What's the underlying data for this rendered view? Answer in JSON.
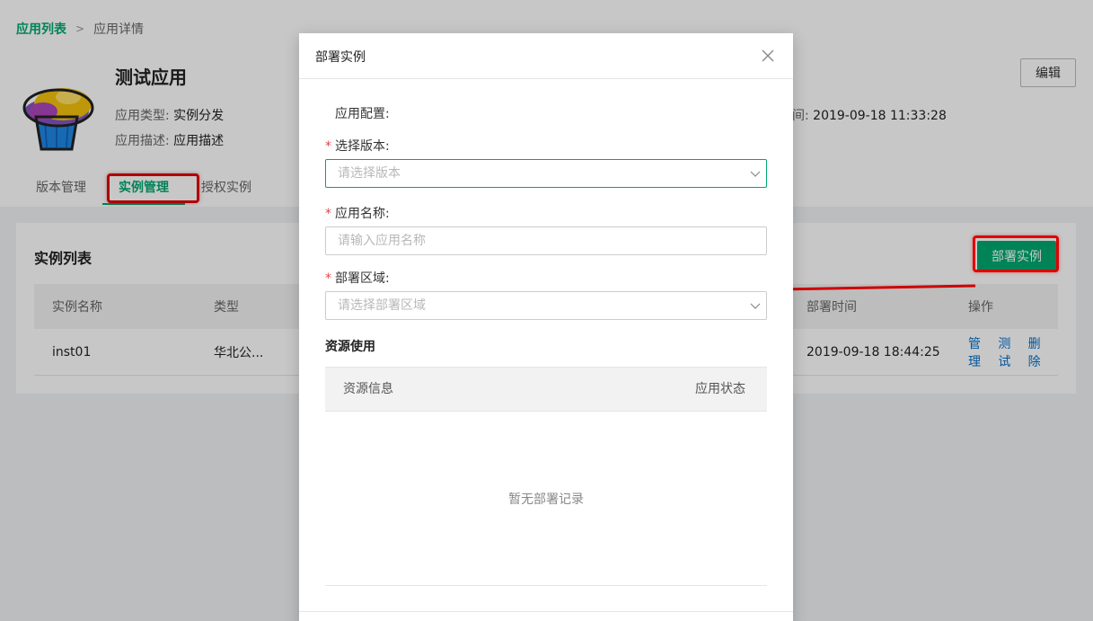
{
  "breadcrumb": {
    "root": "应用列表",
    "separator": ">",
    "current": "应用详情"
  },
  "app": {
    "icon": "cupcake-icon",
    "title": "测试应用",
    "type_label": "应用类型:",
    "type_value": "实例分发",
    "desc_label": "应用描述:",
    "desc_value": "应用描述",
    "time_label_partial": "间:",
    "time_value": "2019-09-18 11:33:28"
  },
  "edit_button": "编辑",
  "tabs": [
    {
      "label": "版本管理",
      "active": false
    },
    {
      "label": "实例管理",
      "active": true
    },
    {
      "label": "授权实例",
      "active": false
    }
  ],
  "instances": {
    "title": "实例列表",
    "deploy_button": "部署实例",
    "columns": [
      "实例名称",
      "类型",
      "部署时间",
      "操作"
    ],
    "rows": [
      {
        "name": "inst01",
        "type": "华北公...",
        "deploy_time": "2019-09-18 18:44:25",
        "actions": [
          "管理",
          "测试",
          "删除"
        ]
      }
    ]
  },
  "modal": {
    "title": "部署实例",
    "close_icon": "close-icon",
    "section": "应用配置:",
    "fields": {
      "version": {
        "label": "选择版本:",
        "required_mark": "*",
        "placeholder": "请选择版本"
      },
      "app_name": {
        "label": "应用名称:",
        "required_mark": "*",
        "placeholder": "请输入应用名称"
      },
      "region": {
        "label": "部署区域:",
        "required_mark": "*",
        "placeholder": "请选择部署区域"
      }
    },
    "resources": {
      "title": "资源使用",
      "col_info": "资源信息",
      "col_status": "应用状态",
      "empty_text": "暂无部署记录"
    }
  },
  "colors": {
    "accent": "#00a870",
    "link": "#0070cc",
    "annotation": "#e00000",
    "required": "#e54545"
  }
}
